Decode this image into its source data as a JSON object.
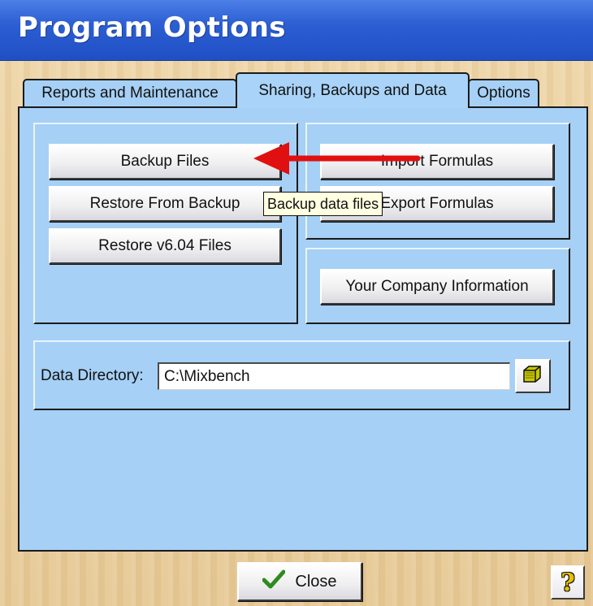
{
  "window": {
    "title": "Program Options"
  },
  "tabs": [
    {
      "label": "Reports and Maintenance",
      "selected": false
    },
    {
      "label": "Sharing, Backups and Data",
      "selected": true
    },
    {
      "label": "Options",
      "selected": false
    }
  ],
  "buttons": {
    "backup": "Backup Files",
    "restore": "Restore From Backup",
    "restore_v604": "Restore v6.04 Files",
    "import_formulas": "Import Formulas",
    "export_formulas": "Export Formulas",
    "company_info": "Your Company Information"
  },
  "data_directory": {
    "label": "Data Directory:",
    "value": "C:\\Mixbench"
  },
  "tooltip": {
    "text": "Backup data files"
  },
  "footer": {
    "close_label": "Close",
    "help_symbol": "?"
  },
  "icons": {
    "folder": "folder-icon",
    "check": "checkmark-icon",
    "help": "help-icon",
    "arrow": "annotation-arrow"
  },
  "colors": {
    "titlebar": "#2c5fd3",
    "panel": "#a6d0f5",
    "tooltip": "#ffffe1",
    "arrow": "#e01010",
    "check": "#2e8b1e"
  }
}
